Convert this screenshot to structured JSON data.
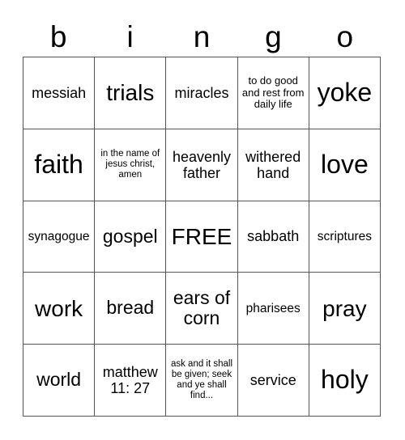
{
  "card": {
    "header_letters": [
      "b",
      "i",
      "n",
      "g",
      "o"
    ],
    "free_space_label": "FREE",
    "colors": {
      "background": "#ffffff",
      "grid_line": "#555555",
      "text": "#000000"
    },
    "rows": [
      [
        {
          "text": "messiah",
          "size": "sm"
        },
        {
          "text": "trials",
          "size": "lg"
        },
        {
          "text": "miracles",
          "size": "sm"
        },
        {
          "text": "to do good and rest from daily life",
          "size": "xxs"
        },
        {
          "text": "yoke",
          "size": "xl"
        }
      ],
      [
        {
          "text": "faith",
          "size": "xl"
        },
        {
          "text": "in the name of jesus christ, amen",
          "size": "tiny"
        },
        {
          "text": "heavenly father",
          "size": "sm"
        },
        {
          "text": "withered hand",
          "size": "sm"
        },
        {
          "text": "love",
          "size": "xl"
        }
      ],
      [
        {
          "text": "synagogue",
          "size": "xs"
        },
        {
          "text": "gospel",
          "size": "md"
        },
        {
          "text": "FREE",
          "size": "lg"
        },
        {
          "text": "sabbath",
          "size": "sm"
        },
        {
          "text": "scriptures",
          "size": "xs"
        }
      ],
      [
        {
          "text": "work",
          "size": "lg"
        },
        {
          "text": "bread",
          "size": "md"
        },
        {
          "text": "ears of corn",
          "size": "md"
        },
        {
          "text": "pharisees",
          "size": "xs"
        },
        {
          "text": "pray",
          "size": "lg"
        }
      ],
      [
        {
          "text": "world",
          "size": "md"
        },
        {
          "text": "matthew 11: 27",
          "size": "sm"
        },
        {
          "text": "ask and it shall be given; seek and ye shall find...",
          "size": "tiny"
        },
        {
          "text": "service",
          "size": "sm"
        },
        {
          "text": "holy",
          "size": "xl"
        }
      ]
    ]
  }
}
